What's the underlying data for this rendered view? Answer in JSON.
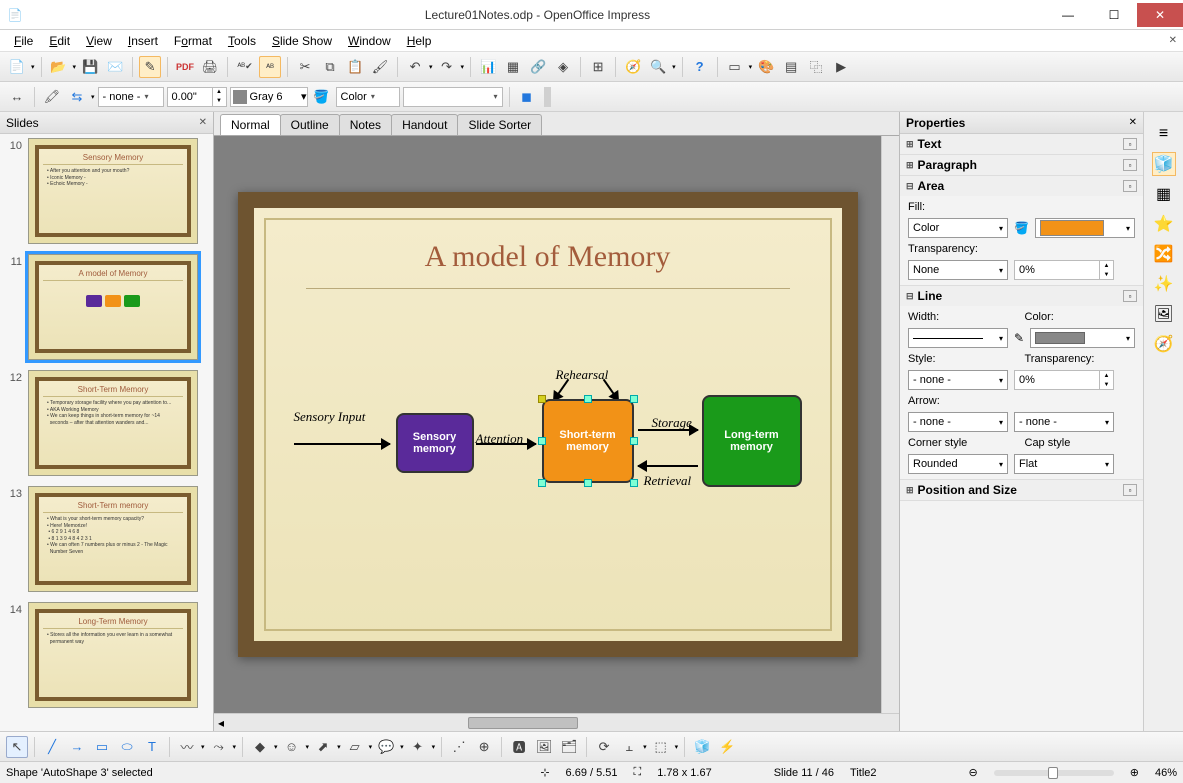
{
  "window": {
    "title": "Lecture01Notes.odp - OpenOffice Impress"
  },
  "menu": [
    "File",
    "Edit",
    "View",
    "Insert",
    "Format",
    "Tools",
    "Slide Show",
    "Window",
    "Help"
  ],
  "toolbar2": {
    "style_dd": "- none -",
    "width": "0.00\"",
    "color_name": "Gray 6",
    "fill_label": "Color"
  },
  "panels": {
    "slides_title": "Slides",
    "props_title": "Properties"
  },
  "view_tabs": [
    "Normal",
    "Outline",
    "Notes",
    "Handout",
    "Slide Sorter"
  ],
  "thumbs": [
    {
      "n": "10",
      "title": "Sensory Memory"
    },
    {
      "n": "11",
      "title": "A model of Memory",
      "sel": true
    },
    {
      "n": "12",
      "title": "Short-Term Memory"
    },
    {
      "n": "13",
      "title": "Short-Term memory"
    },
    {
      "n": "14",
      "title": "Long-Term Memory"
    }
  ],
  "slide": {
    "title": "A model of Memory",
    "labels": {
      "sensory_input": "Sensory Input",
      "attention": "Attention",
      "rehearsal": "Rehearsal",
      "storage": "Storage",
      "retrieval": "Retrieval"
    },
    "boxes": {
      "sensory": "Sensory memory",
      "short": "Short-term memory",
      "long": "Long-term memory"
    }
  },
  "props": {
    "sections": {
      "text": "Text",
      "paragraph": "Paragraph",
      "area": "Area",
      "line": "Line",
      "pos": "Position and Size"
    },
    "area": {
      "fill_label": "Fill:",
      "fill_type": "Color",
      "trans_label": "Transparency:",
      "trans_type": "None",
      "trans_val": "0%"
    },
    "line": {
      "width_label": "Width:",
      "color_label": "Color:",
      "style_label": "Style:",
      "style_val": "- none -",
      "trans_label": "Transparency:",
      "trans_val": "0%",
      "arrow_label": "Arrow:",
      "arrow_l": "- none -",
      "arrow_r": "- none -",
      "corner_label": "Corner style",
      "corner_val": "Rounded",
      "cap_label": "Cap style",
      "cap_val": "Flat"
    }
  },
  "status": {
    "sel": "Shape 'AutoShape 3' selected",
    "pos": "6.69 / 5.51",
    "size": "1.78 x 1.67",
    "slide": "Slide 11 / 46",
    "master": "Title2",
    "zoom": "46%"
  }
}
